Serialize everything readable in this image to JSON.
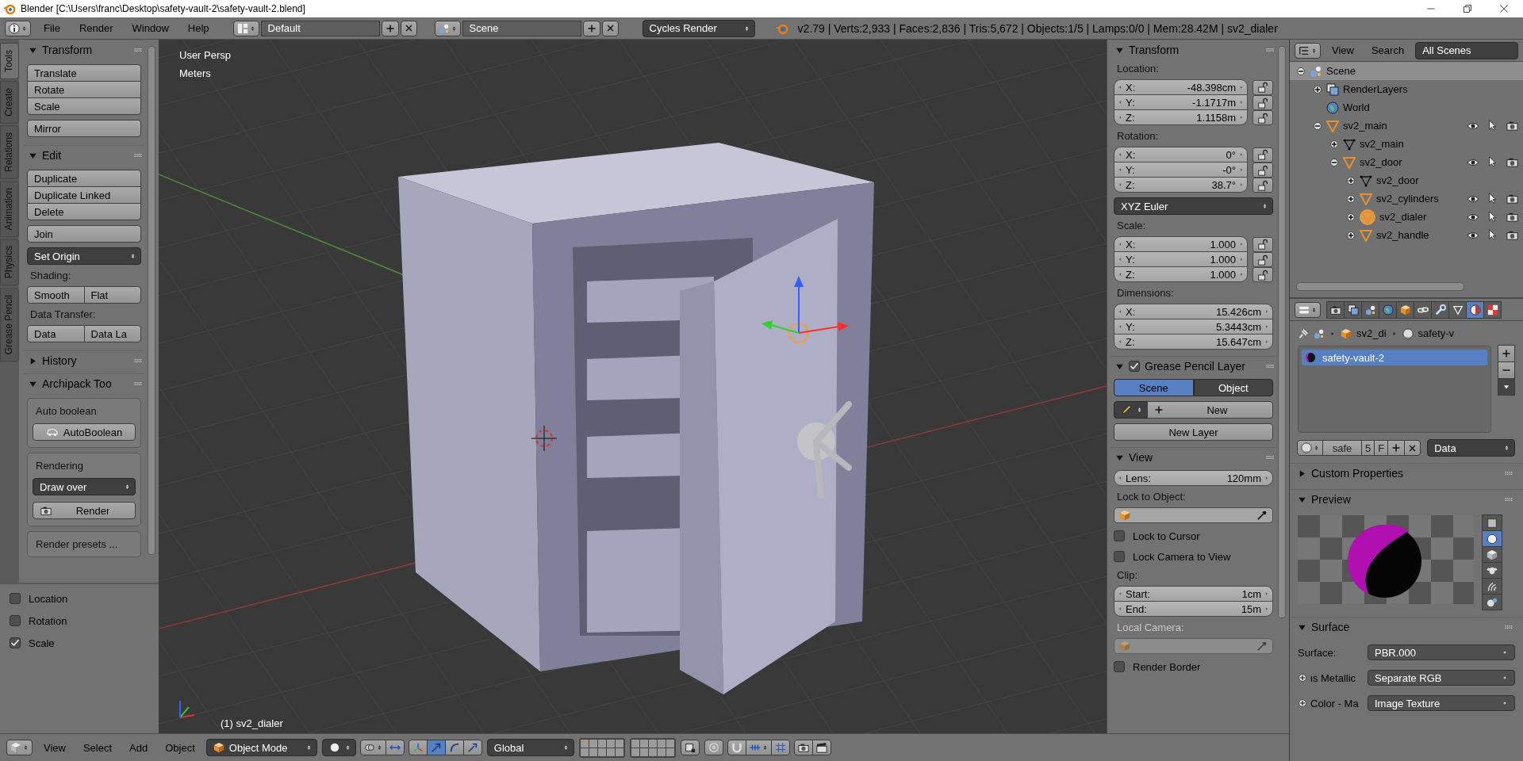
{
  "title_bar": {
    "title": "Blender [C:\\Users\\franc\\Desktop\\safety-vault-2\\safety-vault-2.blend]"
  },
  "info_header": {
    "menus": [
      "File",
      "Render",
      "Window",
      "Help"
    ],
    "screen_layout": "Default",
    "scene": "Scene",
    "render_engine": "Cycles Render",
    "stats": "v2.79 | Verts:2,933 | Faces:2,836 | Tris:5,672 | Objects:1/5 | Lamps:0/0 | Mem:28.42M | sv2_dialer"
  },
  "tool_tabs": [
    {
      "label": "Tools",
      "selected": true
    },
    {
      "label": "Create",
      "selected": false
    },
    {
      "label": "Relations",
      "selected": false
    },
    {
      "label": "Animation",
      "selected": false
    },
    {
      "label": "Physics",
      "selected": false
    },
    {
      "label": "Grease Pencil",
      "selected": false
    }
  ],
  "tool_panels": [
    {
      "title": "Transform",
      "expanded": true,
      "rows": [
        {
          "kind": "stack",
          "buttons": [
            "Translate",
            "Rotate",
            "Scale"
          ]
        },
        {
          "kind": "stack",
          "buttons": [
            "Mirror"
          ]
        }
      ]
    },
    {
      "title": "Edit",
      "expanded": true,
      "rows": [
        {
          "kind": "stack",
          "buttons": [
            "Duplicate",
            "Duplicate Linked",
            "Delete"
          ]
        },
        {
          "kind": "stack",
          "buttons": [
            "Join"
          ]
        },
        {
          "kind": "dropdown",
          "value": "Set Origin"
        },
        {
          "kind": "label",
          "text": "Shading:"
        },
        {
          "kind": "row",
          "buttons": [
            "Smooth",
            "Flat"
          ]
        },
        {
          "kind": "label",
          "text": "Data Transfer:"
        },
        {
          "kind": "row",
          "buttons": [
            "Data",
            "Data La"
          ]
        }
      ]
    },
    {
      "title": "History",
      "expanded": false
    },
    {
      "title": "Archipack Too",
      "expanded": true,
      "rows": [
        {
          "kind": "box",
          "rows": [
            {
              "kind": "label",
              "text": "Auto boolean"
            },
            {
              "kind": "car_button",
              "text": "AutoBoolean"
            }
          ]
        },
        {
          "kind": "box",
          "rows": [
            {
              "kind": "label",
              "text": "Rendering"
            },
            {
              "kind": "dropdown",
              "value": "Draw over"
            },
            {
              "kind": "camera_button",
              "text": "Render"
            }
          ]
        },
        {
          "kind": "box",
          "rows": [
            {
              "kind": "label",
              "text": "Render presets ..."
            }
          ]
        }
      ]
    }
  ],
  "operator_options": [
    {
      "label": "Location",
      "checked": false
    },
    {
      "label": "Rotation",
      "checked": false
    },
    {
      "label": "Scale",
      "checked": true
    }
  ],
  "viewport": {
    "view_name": "User Persp",
    "units": "Meters",
    "active_object": "(1) sv2_dialer"
  },
  "properties_shelf": [
    {
      "title": "Transform",
      "expanded": true,
      "rows": [
        {
          "kind": "label",
          "text": "Location:",
          "disabled": false
        },
        {
          "kind": "vector",
          "fields": [
            {
              "axis": "X:",
              "value": "-48.398cm",
              "locked": false
            },
            {
              "axis": "Y:",
              "value": "-1.1717m",
              "locked": false
            },
            {
              "axis": "Z:",
              "value": "1.1158m",
              "locked": false
            }
          ]
        },
        {
          "kind": "label",
          "text": "Rotation:",
          "disabled": false
        },
        {
          "kind": "vector",
          "fields": [
            {
              "axis": "X:",
              "value": "0°",
              "locked": false
            },
            {
              "axis": "Y:",
              "value": "-0°",
              "locked": false
            },
            {
              "axis": "Z:",
              "value": "38.7°",
              "locked": false
            }
          ]
        },
        {
          "kind": "dropdown",
          "value": "XYZ Euler"
        },
        {
          "kind": "label",
          "text": "Scale:",
          "disabled": false
        },
        {
          "kind": "vector",
          "fields": [
            {
              "axis": "X:",
              "value": "1.000",
              "locked": false
            },
            {
              "axis": "Y:",
              "value": "1.000",
              "locked": false
            },
            {
              "axis": "Z:",
              "value": "1.000",
              "locked": false
            }
          ]
        },
        {
          "kind": "label",
          "text": "Dimensions:",
          "disabled": false
        },
        {
          "kind": "vector",
          "fields": [
            {
              "axis": "X:",
              "value": "15.426cm"
            },
            {
              "axis": "Y:",
              "value": "5.3443cm"
            },
            {
              "axis": "Z:",
              "value": "15.647cm"
            }
          ]
        }
      ]
    },
    {
      "title": "Grease Pencil Layer",
      "expanded": true,
      "checked": true,
      "rows": [
        {
          "kind": "segmented",
          "options": [
            {
              "label": "Scene",
              "selected": true
            },
            {
              "label": "Object",
              "selected": false
            }
          ]
        },
        {
          "kind": "new_row",
          "text": "New"
        },
        {
          "kind": "button",
          "text": "New Layer"
        }
      ]
    },
    {
      "title": "View",
      "expanded": true,
      "rows": [
        {
          "kind": "number",
          "label": "Lens:",
          "value": "120mm"
        },
        {
          "kind": "label",
          "text": "Lock to Object:",
          "disabled": false
        },
        {
          "kind": "object_field",
          "disabled": false
        },
        {
          "kind": "checkbox",
          "label": "Lock to Cursor",
          "checked": false
        },
        {
          "kind": "checkbox",
          "label": "Lock Camera to View",
          "checked": false
        },
        {
          "kind": "label",
          "text": "Clip:",
          "disabled": false
        },
        {
          "kind": "vector",
          "fields": [
            {
              "axis": "Start:",
              "value": "1cm"
            },
            {
              "axis": "End:",
              "value": "15m"
            }
          ]
        },
        {
          "kind": "label",
          "text": "Local Camera:",
          "disabled": true
        },
        {
          "kind": "object_field",
          "disabled": true
        },
        {
          "kind": "checkbox",
          "label": "Render Border",
          "checked": false
        }
      ]
    }
  ],
  "outliner": {
    "menus": [
      "View",
      "Search"
    ],
    "filter": "All Scenes",
    "tree": [
      {
        "name": "Scene",
        "kind": "scene",
        "expanded": true,
        "selected": true,
        "active": false,
        "children": [
          {
            "name": "RenderLayers",
            "kind": "render_layers",
            "expanded": false,
            "selected": false,
            "active": false
          },
          {
            "name": "World",
            "kind": "world",
            "selected": false,
            "active": false
          },
          {
            "name": "sv2_main",
            "kind": "object",
            "expanded": true,
            "selected": false,
            "active": false,
            "children": [
              {
                "name": "sv2_main",
                "kind": "mesh",
                "expanded": false,
                "selected": false,
                "active": false
              },
              {
                "name": "sv2_door",
                "kind": "object",
                "expanded": true,
                "selected": false,
                "active": false,
                "children": [
                  {
                    "name": "sv2_door",
                    "kind": "mesh",
                    "expanded": false,
                    "selected": false,
                    "active": false
                  },
                  {
                    "name": "sv2_cylinders",
                    "kind": "object",
                    "expanded": false,
                    "selected": false,
                    "active": false
                  },
                  {
                    "name": "sv2_dialer",
                    "kind": "object",
                    "expanded": false,
                    "selected": false,
                    "active": true
                  },
                  {
                    "name": "sv2_handle",
                    "kind": "object",
                    "expanded": false,
                    "selected": false,
                    "active": false
                  }
                ]
              }
            ]
          }
        ]
      }
    ]
  },
  "properties": {
    "tabs": [
      {
        "kind": "render",
        "selected": false
      },
      {
        "kind": "render_layers",
        "selected": false
      },
      {
        "kind": "scene",
        "selected": false
      },
      {
        "kind": "world",
        "selected": false
      },
      {
        "kind": "object",
        "selected": false
      },
      {
        "kind": "constraints",
        "selected": false
      },
      {
        "kind": "modifiers",
        "selected": false
      },
      {
        "kind": "data",
        "selected": false
      },
      {
        "kind": "material",
        "selected": true
      },
      {
        "kind": "texture",
        "selected": false
      }
    ],
    "breadcrumb": [
      "sv2_di",
      "safety-v"
    ],
    "material_slots": [
      {
        "name": "safety-vault-2",
        "selected": true
      }
    ],
    "material": {
      "name": "safe",
      "users": "5",
      "fake_user": "F",
      "link": "Data"
    },
    "panels": [
      {
        "title": "Custom Properties",
        "expanded": false
      },
      {
        "title": "Preview",
        "expanded": true,
        "preview_shapes": [
          {
            "kind": "plane",
            "selected": false
          },
          {
            "kind": "sphere",
            "selected": true
          },
          {
            "kind": "cube",
            "selected": false
          },
          {
            "kind": "monkey",
            "selected": false
          },
          {
            "kind": "hair",
            "selected": false
          },
          {
            "kind": "sky",
            "selected": false
          }
        ]
      },
      {
        "title": "Surface",
        "expanded": true,
        "fields": [
          {
            "label": "Surface:",
            "value": "PBR.000",
            "socket": false
          },
          {
            "label": "is Metallic",
            "value": "Separate RGB",
            "socket": true
          },
          {
            "label": "Color - Ma",
            "value": "Image Texture",
            "socket": true
          }
        ]
      }
    ]
  },
  "view3d_header": {
    "menus": [
      "View",
      "Select",
      "Add",
      "Object"
    ],
    "mode": "Object Mode",
    "manipulators": [
      {
        "kind": "axes",
        "selected": false
      },
      {
        "kind": "translate",
        "selected": true
      },
      {
        "kind": "rotate",
        "selected": false
      },
      {
        "kind": "scale",
        "selected": false
      }
    ],
    "orientation": "Global",
    "layers": [
      {
        "occupied": true
      },
      {
        "occupied": false
      },
      {
        "occupied": false
      },
      {
        "occupied": false
      },
      {
        "occupied": false
      },
      {
        "occupied": false
      },
      {
        "occupied": false
      },
      {
        "occupied": false
      },
      {
        "occupied": false
      },
      {
        "occupied": false
      },
      {
        "occupied": false
      },
      {
        "occupied": false
      },
      {
        "occupied": false
      },
      {
        "occupied": false
      },
      {
        "occupied": false
      },
      {
        "occupied": false
      },
      {
        "occupied": false
      },
      {
        "occupied": false
      },
      {
        "occupied": false
      },
      {
        "occupied": false
      }
    ]
  }
}
